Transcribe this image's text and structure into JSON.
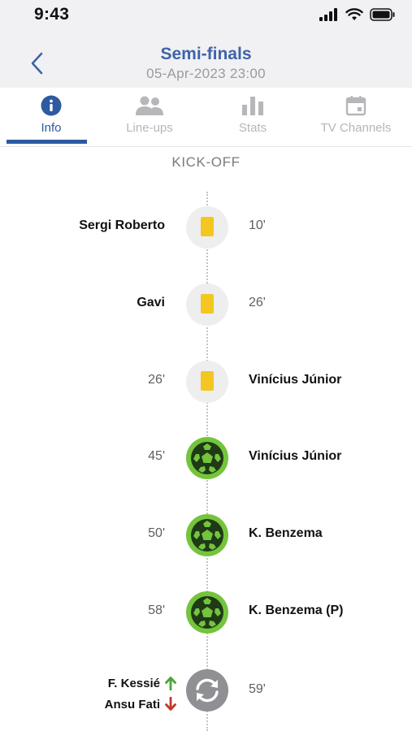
{
  "status": {
    "time": "9:43"
  },
  "header": {
    "title": "Semi-finals",
    "subtitle": "05-Apr-2023 23:00"
  },
  "tabs": [
    {
      "label": "Info",
      "icon": "info-icon",
      "active": true
    },
    {
      "label": "Line-ups",
      "icon": "people-icon",
      "active": false
    },
    {
      "label": "Stats",
      "icon": "bar-chart-icon",
      "active": false
    },
    {
      "label": "TV Channels",
      "icon": "calendar-icon",
      "active": false
    }
  ],
  "timeline": {
    "kickoff_label": "KICK-OFF",
    "events": [
      {
        "type": "yellow-card",
        "side": "left",
        "player": "Sergi Roberto",
        "minute": "10'"
      },
      {
        "type": "yellow-card",
        "side": "left",
        "player": "Gavi",
        "minute": "26'"
      },
      {
        "type": "yellow-card",
        "side": "right",
        "player": "Vinícius Júnior",
        "minute": "26'"
      },
      {
        "type": "goal",
        "side": "right",
        "player": "Vinícius Júnior",
        "minute": "45'"
      },
      {
        "type": "goal",
        "side": "right",
        "player": "K. Benzema",
        "minute": "50'"
      },
      {
        "type": "goal",
        "side": "right",
        "player": "K. Benzema (P)",
        "minute": "58'"
      },
      {
        "type": "substitution",
        "side": "left",
        "player_in": "F. Kessié",
        "player_out": "Ansu Fati",
        "minute": "59'"
      }
    ]
  },
  "colors": {
    "accent": "#2d5aa0",
    "title": "#3f63a8",
    "yellow_card": "#f3c621",
    "goal": "#74c43c",
    "sub_in": "#4aa63a",
    "sub_out": "#c0392b"
  }
}
